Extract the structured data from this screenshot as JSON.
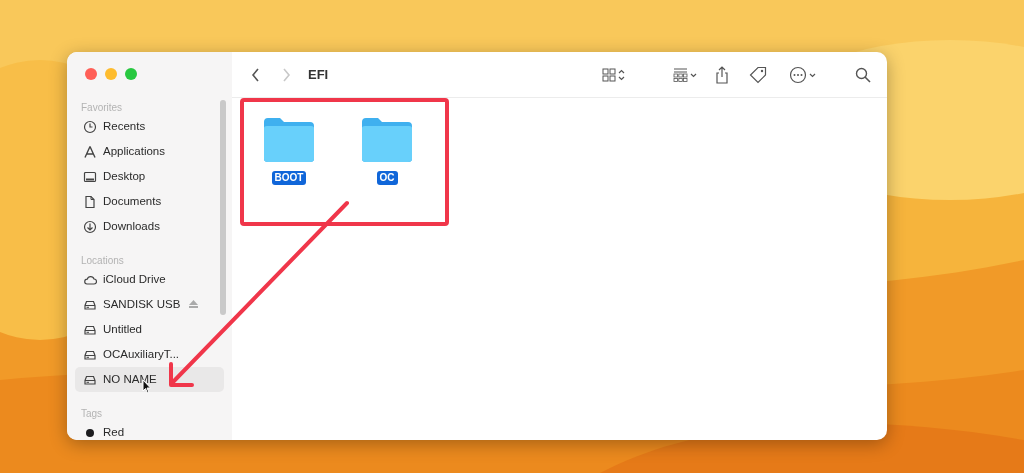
{
  "window": {
    "title": "EFI"
  },
  "nav": [
    {
      "kind": "back",
      "disabled": false
    },
    {
      "kind": "forward",
      "disabled": true
    }
  ],
  "sidebar": [
    {
      "heading": "Favorites",
      "items": [
        {
          "label": "Recents",
          "kind": "clock",
          "selected": false
        },
        {
          "label": "Applications",
          "kind": "apps",
          "selected": false
        },
        {
          "label": "Desktop",
          "kind": "desktop",
          "selected": false
        },
        {
          "label": "Documents",
          "kind": "document",
          "selected": false
        },
        {
          "label": "Downloads",
          "kind": "download",
          "selected": false
        }
      ]
    },
    {
      "heading": "Locations",
      "items": [
        {
          "label": "iCloud Drive",
          "kind": "cloud",
          "selected": false,
          "eject": false
        },
        {
          "label": "SANDISK USB",
          "kind": "drive",
          "selected": false,
          "eject": true
        },
        {
          "label": "Untitled",
          "kind": "drive",
          "selected": false,
          "eject": false
        },
        {
          "label": "OCAuxiliaryT...",
          "kind": "drive",
          "selected": false,
          "eject": false
        },
        {
          "label": "NO NAME",
          "kind": "drive",
          "selected": true,
          "eject": false
        }
      ]
    },
    {
      "heading": "Tags",
      "items": [
        {
          "label": "Red",
          "kind": "tag",
          "selected": false,
          "color": "#1c1c1e"
        }
      ]
    }
  ],
  "files": [
    {
      "name": "BOOT",
      "selected": true
    },
    {
      "name": "OC",
      "selected": true
    }
  ]
}
